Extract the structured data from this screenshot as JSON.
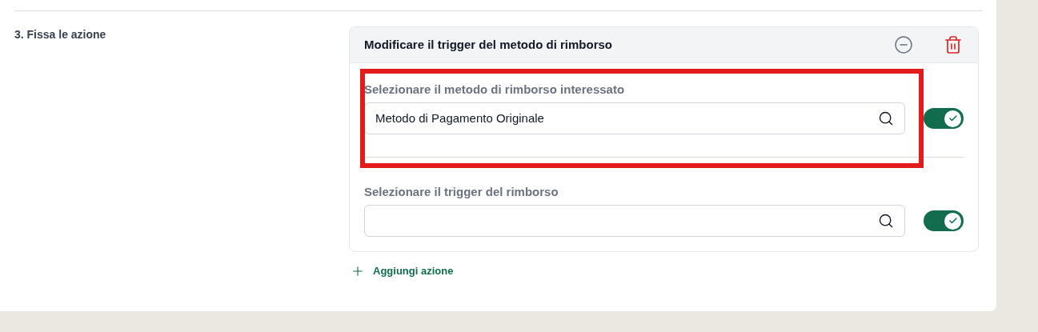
{
  "step": {
    "label": "3. Fissa le azione"
  },
  "action_card": {
    "title": "Modificare il trigger del metodo di rimborso",
    "fields": [
      {
        "label": "Selezionare il metodo di rimborso interessato",
        "value": "Metodo di Pagamento Originale",
        "on": true,
        "highlighted": true
      },
      {
        "label": "Selezionare il trigger del rimborso",
        "on": true,
        "highlighted": false
      }
    ]
  },
  "add_action": {
    "label": "Aggiungi azione"
  }
}
